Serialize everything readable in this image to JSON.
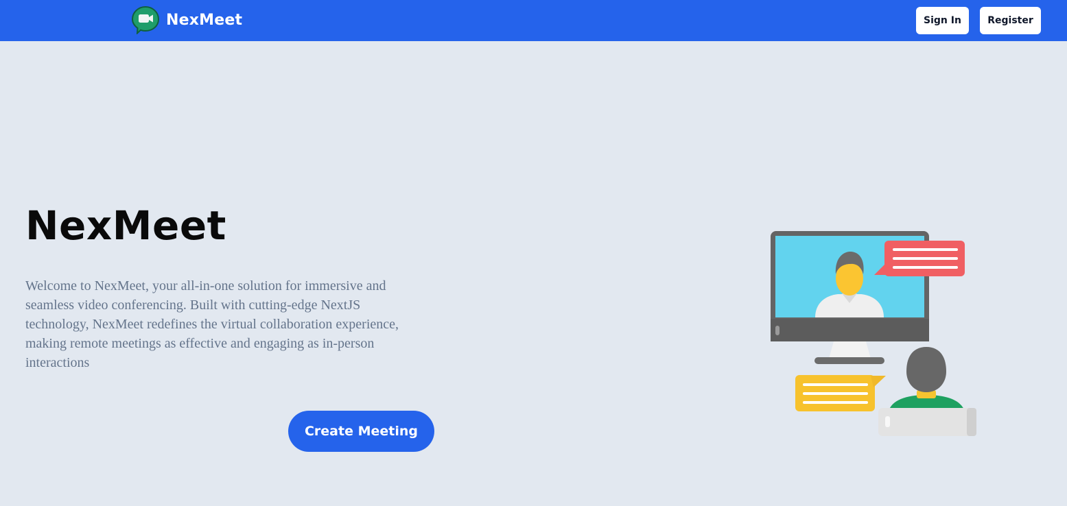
{
  "navbar": {
    "brand_name": "NexMeet",
    "logo_icon": "video-chat-bubble-icon",
    "signin_label": "Sign In",
    "register_label": "Register",
    "background_color": "#2563eb"
  },
  "hero": {
    "title": "NexMeet",
    "description": "Welcome to NexMeet, your all-in-one solution for immersive and seamless video conferencing. Built with cutting-edge NextJS technology, NexMeet redefines the virtual collaboration experience, making remote meetings as effective and engaging as in-person interactions",
    "cta_label": "Create Meeting",
    "illustration_icon": "video-conference-illustration"
  },
  "colors": {
    "accent": "#2563eb",
    "page_background": "#e2e8f0",
    "text_muted": "#64748b"
  }
}
